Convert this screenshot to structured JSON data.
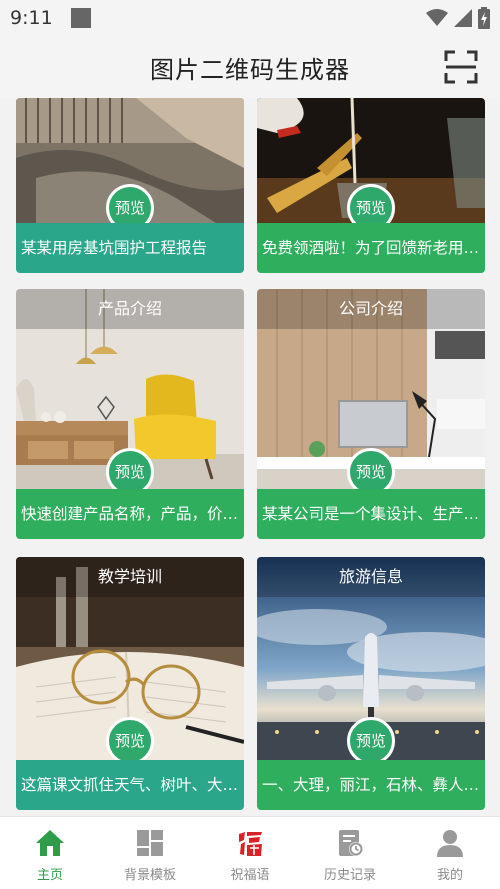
{
  "status_bar": {
    "time": "9:11"
  },
  "header": {
    "title": "图片二维码生成器"
  },
  "cards": [
    {
      "title": "",
      "preview": "预览",
      "caption": "某某用房基坑围护工程报告"
    },
    {
      "title": "",
      "preview": "预览",
      "caption": "免费领酒啦！为了回馈新老用…"
    },
    {
      "title": "产品介绍",
      "preview": "预览",
      "caption": "快速创建产品名称，产品，价…"
    },
    {
      "title": "公司介绍",
      "preview": "预览",
      "caption": "某某公司是一个集设计、生产…"
    },
    {
      "title": "教学培训",
      "preview": "预览",
      "caption": "这篇课文抓住天气、树叶、大…"
    },
    {
      "title": "旅游信息",
      "preview": "预览",
      "caption": "一、大理，丽江，石林、彝人…"
    }
  ],
  "tabs": [
    {
      "label": "主页",
      "icon": "home-icon",
      "active": true
    },
    {
      "label": "背景模板",
      "icon": "template-icon"
    },
    {
      "label": "祝福语",
      "icon": "fu-icon"
    },
    {
      "label": "历史记录",
      "icon": "history-icon"
    },
    {
      "label": "我的",
      "icon": "profile-icon"
    }
  ],
  "colors": {
    "accent_green": "#2fa86b",
    "tab_active": "#2d9d4a",
    "fu_red": "#d9232a"
  }
}
